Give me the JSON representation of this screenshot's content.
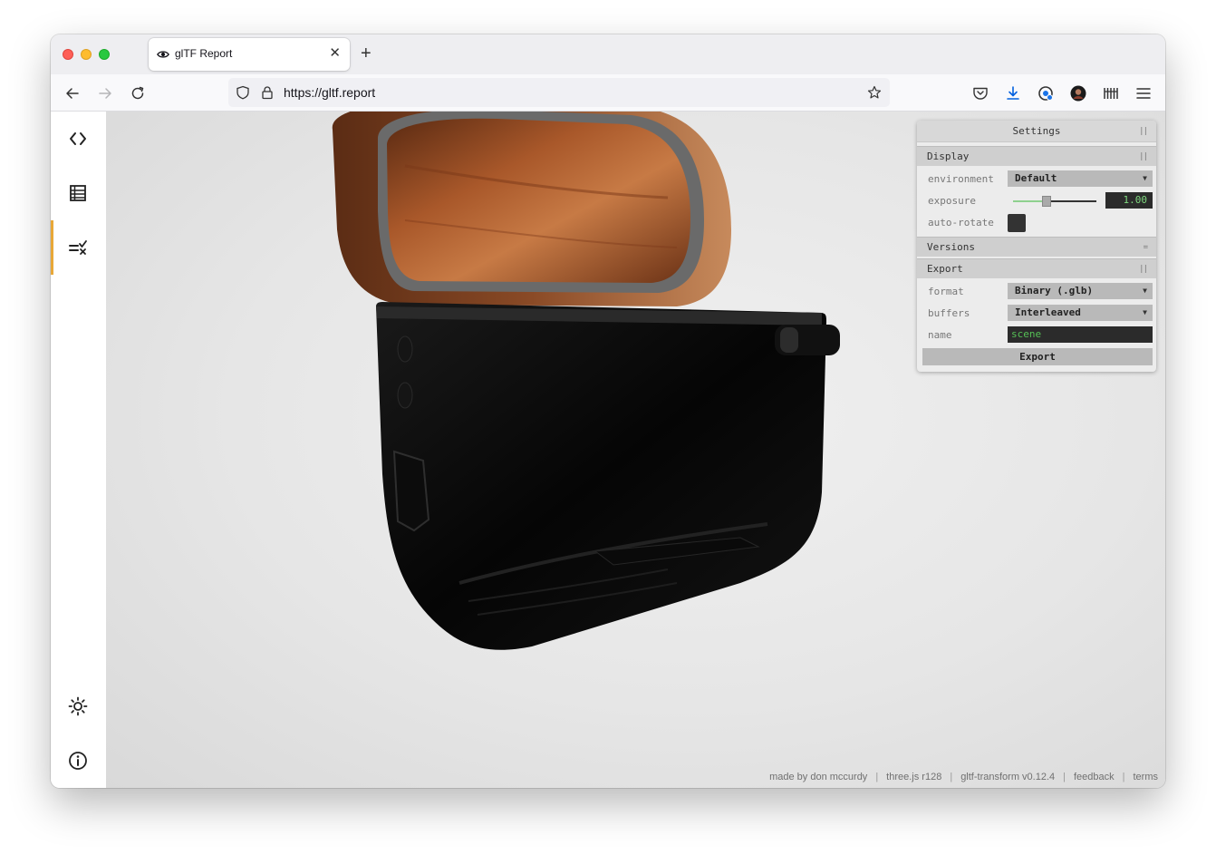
{
  "browser": {
    "tab_title": "glTF Report",
    "tab_icon": "eye-icon",
    "url": "https://gltf.report",
    "close_glyph": "✕",
    "new_tab_glyph": "+"
  },
  "sidebar": {
    "items": [
      {
        "name": "code-icon",
        "active": false
      },
      {
        "name": "table-icon",
        "active": false
      },
      {
        "name": "checklist-icon",
        "active": true
      },
      {
        "name": "sun-icon",
        "active": false
      },
      {
        "name": "info-icon",
        "active": false
      }
    ],
    "accent": "#e8a838"
  },
  "settings": {
    "title": "Settings",
    "display": {
      "label": "Display",
      "environment_label": "environment",
      "environment_value": "Default",
      "exposure_label": "exposure",
      "exposure_value": "1.00",
      "autorotate_label": "auto-rotate"
    },
    "versions": {
      "label": "Versions"
    },
    "export": {
      "label": "Export",
      "format_label": "format",
      "format_value": "Binary (.glb)",
      "buffers_label": "buffers",
      "buffers_value": "Interleaved",
      "name_label": "name",
      "name_value": "scene",
      "button_label": "Export"
    }
  },
  "footer": {
    "items": [
      "made by don mccurdy",
      "three.js r128",
      "gltf-transform v0.12.4",
      "feedback",
      "terms"
    ],
    "separator": "|"
  }
}
